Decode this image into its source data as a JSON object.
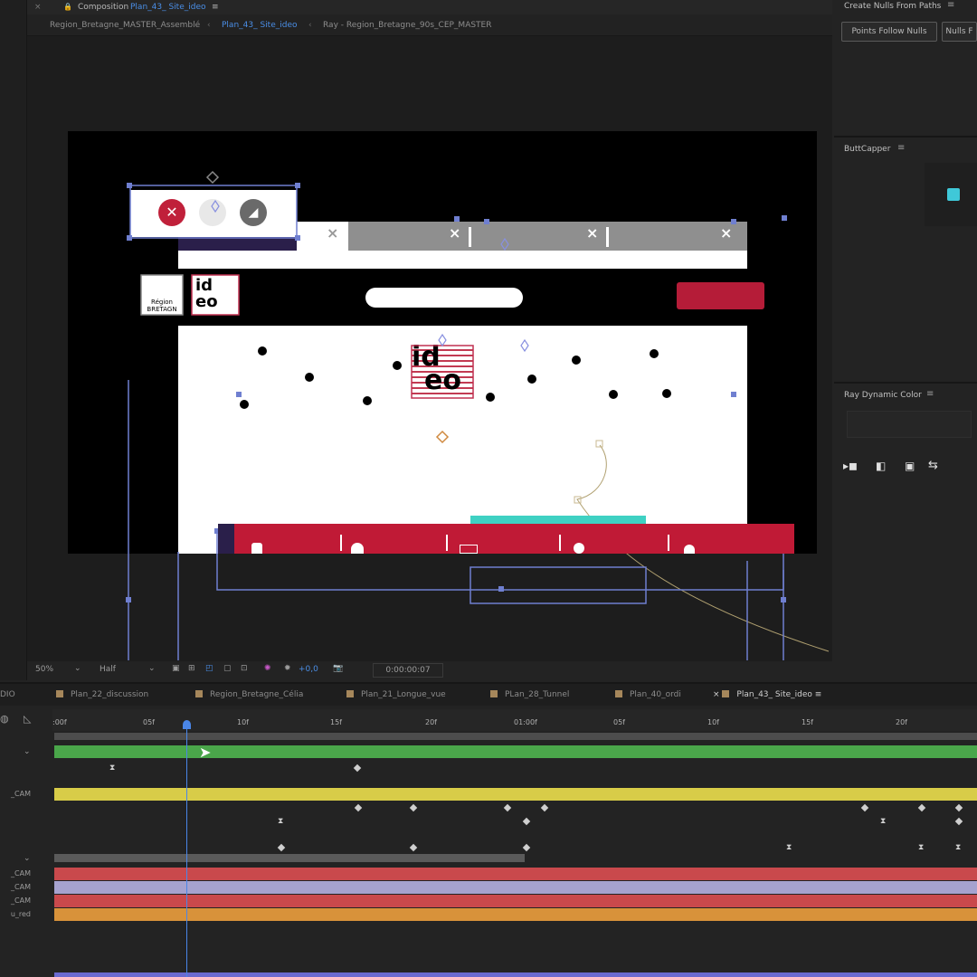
{
  "comp": {
    "panel_label": "Composition",
    "name": "Plan_43_ Site_ideo",
    "breadcrumbs": [
      "Region_Bretagne_MASTER_Assemblé",
      "Plan_43_ Site_ideo",
      "Ray - Region_Bretagne_90s_CEP_MASTER"
    ]
  },
  "panels": {
    "create_nulls": {
      "title": "Create Nulls From Paths",
      "btn1": "Points Follow Nulls",
      "btn2": "Nulls F"
    },
    "buttcapper": {
      "title": "ButtCapper"
    },
    "ray_dynamic": {
      "title": "Ray Dynamic Color"
    }
  },
  "viewer": {
    "zoom": "50%",
    "quality": "Half",
    "exposure": "+0,0",
    "timecode": "0:00:00:07"
  },
  "preview": {
    "logo_line1": "id",
    "logo_line2": "eo",
    "region_label": "Région",
    "region_label2": "BRETAGN"
  },
  "timeline": {
    "tabs": [
      "DIO",
      "Plan_22_discussion",
      "Region_Bretagne_Célia",
      "Plan_21_Longue_vue",
      "PLan_28_Tunnel",
      "Plan_40_ordi",
      "Plan_43_ Site_ideo"
    ],
    "ruler": [
      ":00f",
      "05f",
      "10f",
      "15f",
      "20f",
      "01:00f",
      "05f",
      "10f",
      "15f",
      "20f"
    ],
    "layers": [
      "_CAM",
      "_CAM",
      "_CAM",
      "_CAM",
      "u_red"
    ],
    "colors": {
      "green": "#4aa64a",
      "yellow": "#d8cc48",
      "red": "#c9494c",
      "lavender": "#a6a2cf",
      "orange": "#d8923a",
      "playhead": "#4a86e8"
    }
  }
}
